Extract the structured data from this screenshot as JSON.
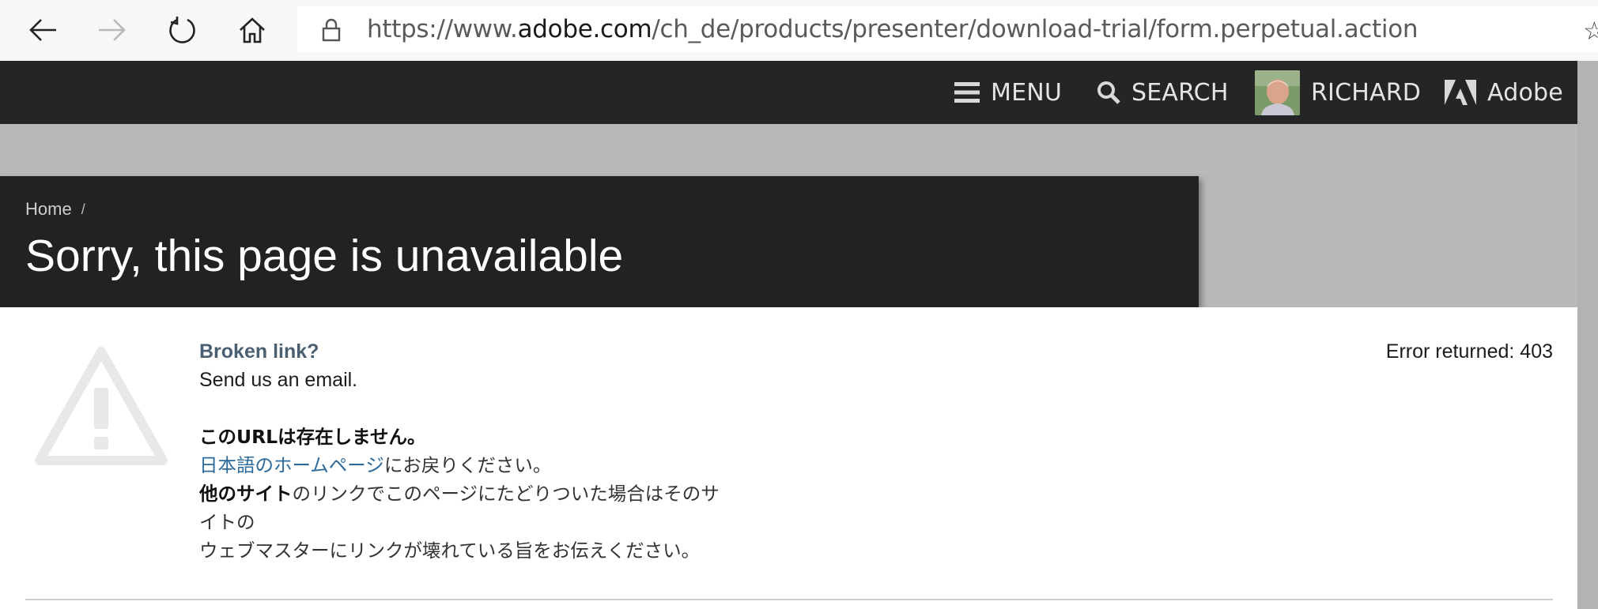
{
  "browser": {
    "url_prefix": "https://www.",
    "url_domain": "adobe.com",
    "url_path": "/ch_de/products/presenter/download-trial/form.perpetual.action",
    "star_glyph": "☆"
  },
  "topnav": {
    "menu_label": "MENU",
    "search_label": "SEARCH",
    "user_label": "RICHARD",
    "brand_label": "Adobe"
  },
  "header": {
    "breadcrumb_home": "Home",
    "breadcrumb_sep": "/",
    "title": "Sorry, this page is unavailable"
  },
  "content": {
    "broken_link": "Broken link?",
    "send_email": "Send us an email.",
    "jp_heading": "このURLは存在しません。",
    "jp_home_link": "日本語のホームページ",
    "jp_home_suffix": "にお戻りください。",
    "jp_line3_bold": "他のサイト",
    "jp_line3_rest": "のリンクでこのページにたどりついた場合はそのサ",
    "jp_line4": "イトの",
    "jp_line5": "ウェブマスターにリンクが壊れている旨をお伝えください。",
    "error": "Error returned: 403"
  },
  "colors": {
    "nav_bg": "#252525",
    "page_bg": "#b9b9b9",
    "link_blue": "#2b6a9b",
    "broken_link": "#4a5f72"
  },
  "icons": [
    "back-arrow-icon",
    "forward-arrow-icon",
    "refresh-icon",
    "home-icon",
    "lock-icon",
    "favorite-star-icon",
    "menu-icon",
    "search-icon",
    "adobe-logo-icon",
    "warning-icon"
  ]
}
